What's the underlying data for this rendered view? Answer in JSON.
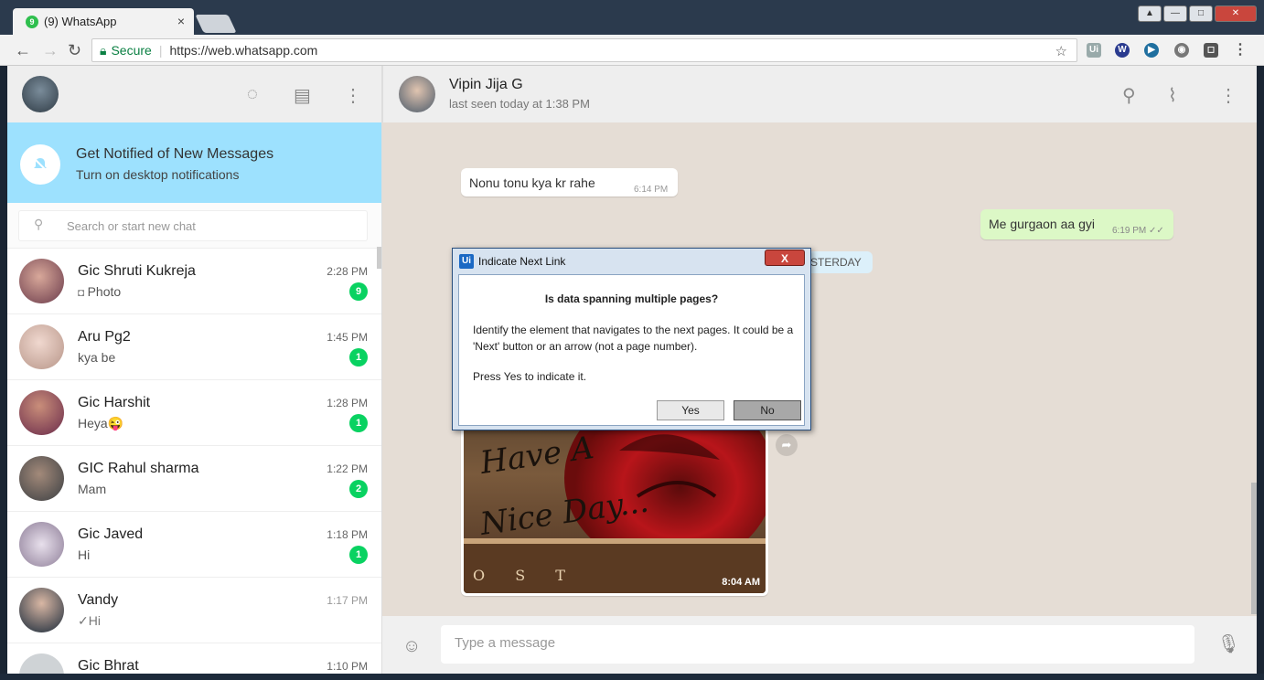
{
  "browser": {
    "tab_title": "(9) WhatsApp",
    "tab_badge": "9",
    "tab_close": "×",
    "secure_label": "Secure",
    "url": "https://web.whatsapp.com"
  },
  "sidebar": {
    "notification": {
      "title": "Get Notified of New Messages",
      "subtitle": "Turn on desktop notifications"
    },
    "search_placeholder": "Search or start new chat",
    "chats": [
      {
        "name": "Gic Shruti Kukreja",
        "last": "Photo",
        "time": "2:28 PM",
        "unread": "9",
        "color": "#8a5a6a"
      },
      {
        "name": "Aru Pg2",
        "last": "kya be",
        "time": "1:45 PM",
        "unread": "1",
        "color": "#c7a7a0"
      },
      {
        "name": "Gic Harshit",
        "last": "Heya😜",
        "time": "1:28 PM",
        "unread": "1",
        "color": "#7a4a5a"
      },
      {
        "name": "GIC Rahul sharma",
        "last": "Mam",
        "time": "1:22 PM",
        "unread": "2",
        "color": "#5a5e62"
      },
      {
        "name": "Gic Javed",
        "last": "Hi",
        "time": "1:18 PM",
        "unread": "1",
        "color": "#b8aebe"
      },
      {
        "name": "Vandy",
        "last": "✓Hi",
        "time": "1:17 PM",
        "unread": "",
        "color": "#2a3a4a"
      },
      {
        "name": "Gic Bhrat",
        "last": "",
        "time": "1:10 PM",
        "unread": "",
        "color": "#cfd3d6"
      }
    ]
  },
  "conversation": {
    "contact_name": "Vipin Jija G",
    "contact_status": "last seen today at 1:38 PM",
    "messages": [
      {
        "text": "Nonu tonu kya kr rahe",
        "time": "6:14 PM"
      },
      {
        "text": "Me gurgaon aa gyi",
        "time": "6:19 PM ✓✓"
      }
    ],
    "date_chip": "YESTERDAY",
    "image_time": "8:04 AM",
    "image_caption_1": "Have A",
    "image_caption_2": "Nice Day...",
    "image_book_text": "O S T",
    "composer_placeholder": "Type a message"
  },
  "dialog": {
    "title": "Indicate Next Link",
    "logo": "Ui",
    "close": "X",
    "question": "Is data spanning multiple pages?",
    "description": "Identify the element that navigates to the next pages. It could be a 'Next' button or an arrow (not a page number).",
    "press": "Press Yes to indicate it.",
    "yes": "Yes",
    "no": "No"
  },
  "colors": {
    "accent_green": "#09d261",
    "notification_bg": "#9de1fe",
    "chat_bg": "#e5ddd5",
    "outgoing_bubble": "#dcf8c6"
  }
}
